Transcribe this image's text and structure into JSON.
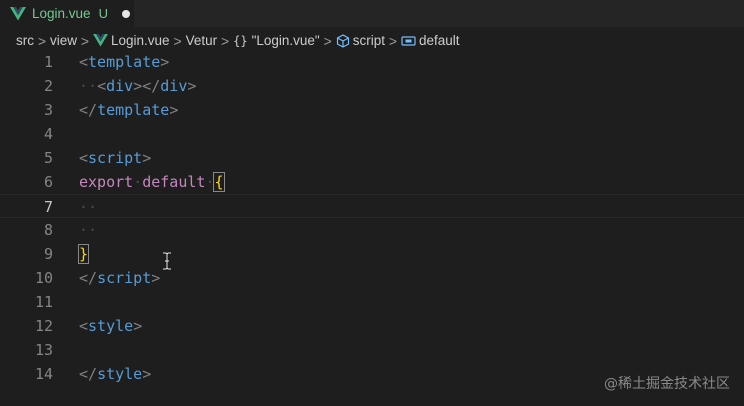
{
  "tab": {
    "title": "Login.vue",
    "status": "U",
    "icon": "vue-icon",
    "accent_color": "#73c991"
  },
  "breadcrumb": {
    "items": [
      {
        "label": "src"
      },
      {
        "label": "view"
      },
      {
        "label": "Login.vue",
        "icon": "vue-icon"
      },
      {
        "label": "Vetur"
      },
      {
        "label": "\"Login.vue\"",
        "icon": "braces-icon"
      },
      {
        "label": "script",
        "icon": "cube-icon"
      },
      {
        "label": "default",
        "icon": "field-icon"
      }
    ],
    "separator": ">"
  },
  "editor": {
    "current_line": 7,
    "lines": [
      {
        "number": "1"
      },
      {
        "number": "2"
      },
      {
        "number": "3"
      },
      {
        "number": "4"
      },
      {
        "number": "5"
      },
      {
        "number": "6"
      },
      {
        "number": "7"
      },
      {
        "number": "8"
      },
      {
        "number": "9"
      },
      {
        "number": "10"
      },
      {
        "number": "11"
      },
      {
        "number": "12"
      },
      {
        "number": "13"
      },
      {
        "number": "14"
      }
    ],
    "tokens": {
      "lt": "<",
      "gt": ">",
      "close_lt": "</",
      "template": "template",
      "div": "div",
      "script": "script",
      "style": "style",
      "export": "export",
      "default": "default",
      "open_brace": "{",
      "close_brace": "}",
      "ws_dots_2": "··",
      "ws_dot_1": "·"
    }
  },
  "watermark": "@稀土掘金技术社区"
}
